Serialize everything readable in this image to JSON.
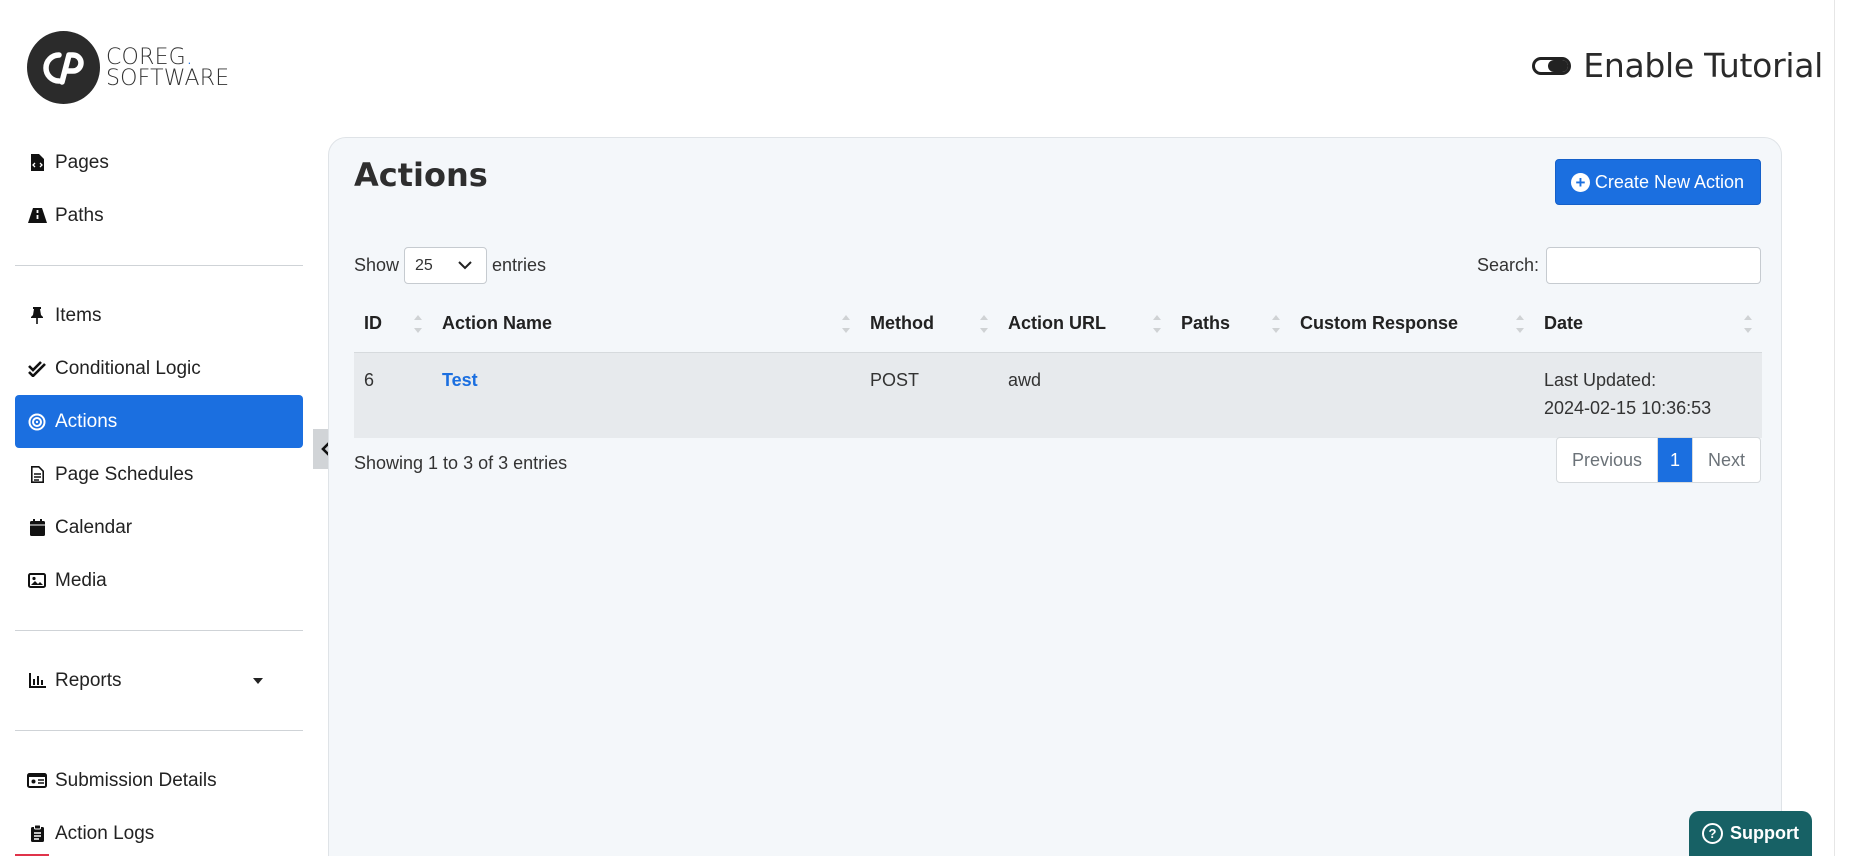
{
  "brand": {
    "line1": "COREG",
    "dot": ".",
    "line2": "SOFTWARE",
    "mark_letters": "CP"
  },
  "tutorial": {
    "label": "Enable Tutorial",
    "enabled": false
  },
  "sidebar": {
    "items": [
      {
        "label": "Pages",
        "icon": "file-code-icon"
      },
      {
        "label": "Paths",
        "icon": "road-icon"
      },
      {
        "label": "Items",
        "icon": "thumbtack-icon"
      },
      {
        "label": "Conditional Logic",
        "icon": "check-double-icon"
      },
      {
        "label": "Actions",
        "icon": "bullseye-icon",
        "active": true
      },
      {
        "label": "Page Schedules",
        "icon": "file-lines-icon"
      },
      {
        "label": "Calendar",
        "icon": "calendar-icon"
      },
      {
        "label": "Media",
        "icon": "image-icon"
      },
      {
        "label": "Reports",
        "icon": "chart-icon"
      },
      {
        "label": "Submission Details",
        "icon": "id-card-icon"
      },
      {
        "label": "Action Logs",
        "icon": "clipboard-icon"
      }
    ]
  },
  "main": {
    "title": "Actions",
    "create_button": "Create New Action",
    "show_label": "Show",
    "page_length": "25",
    "entries_label": "entries",
    "search_label": "Search:",
    "search_value": "",
    "columns": [
      "ID",
      "Action Name",
      "Method",
      "Action URL",
      "Paths",
      "Custom Response",
      "Date"
    ],
    "rows": [
      {
        "id": "6",
        "name": "Test",
        "method": "POST",
        "url": "awd",
        "paths": "",
        "custom_response": "",
        "date_label": "Last Updated:",
        "date_value": "2024-02-15 10:36:53"
      }
    ],
    "info": "Showing 1 to 3 of 3 entries",
    "pagination": {
      "previous": "Previous",
      "current": "1",
      "next": "Next"
    }
  },
  "support": {
    "label": "Support"
  },
  "colors": {
    "accent": "#1b6fe0",
    "support": "#176165",
    "card_bg": "#f4f7fa"
  }
}
